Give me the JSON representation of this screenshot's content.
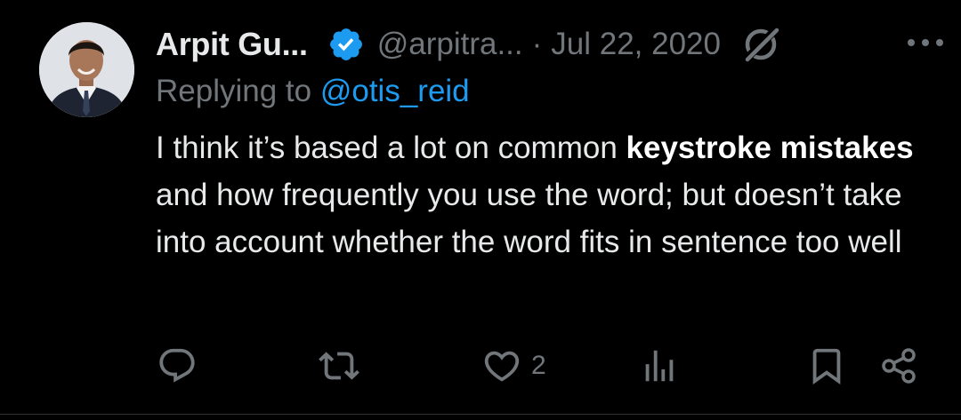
{
  "tweet": {
    "author": {
      "display_name": "Arpit Gu...",
      "handle": "@arpitra...",
      "verified": true,
      "avatar_icon": "profile-photo"
    },
    "separator": "·",
    "date": "Jul 22, 2020",
    "reply": {
      "prefix": "Replying to ",
      "handle": "@otis_reid"
    },
    "body": {
      "part1": "I think it’s based a lot on common ",
      "bold1": "keystroke mistakes",
      "part2": " and how frequently you use the word; but doesn’t take into account whether the word fits in sentence too well"
    },
    "actions": {
      "reply_icon": "reply-icon",
      "retweet_icon": "retweet-icon",
      "like_icon": "heart-icon",
      "like_count": "2",
      "views_icon": "views-icon",
      "bookmark_icon": "bookmark-icon",
      "share_icon": "share-icon"
    }
  },
  "colors": {
    "background": "#000000",
    "text": "#e7e9ea",
    "muted": "#71767b",
    "accent": "#1d9bf0"
  }
}
